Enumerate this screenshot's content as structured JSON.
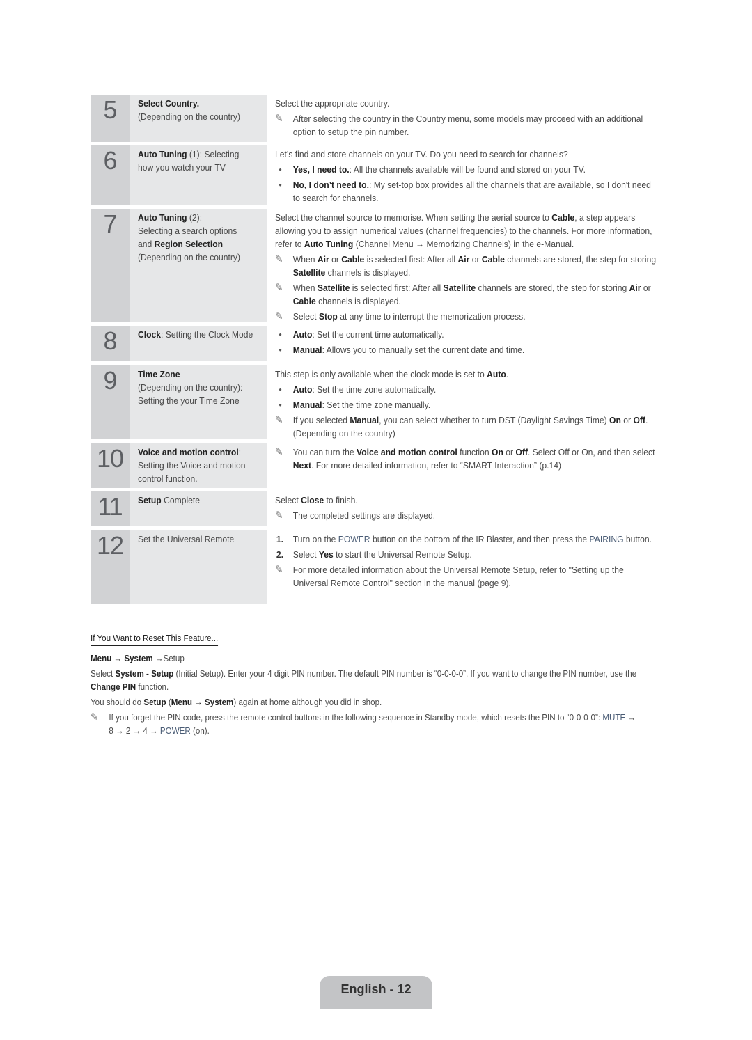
{
  "steps": [
    {
      "number": "5",
      "title_bold": "Select Country.",
      "title_rest": "(Depending on the country)",
      "intro": "Select the appropriate country.",
      "notes": [
        "After selecting the country in the Country menu, some models may proceed with an additional option to setup the pin number."
      ]
    },
    {
      "number": "6",
      "title_bold": "Auto Tuning",
      "title_rest": " (1): Selecting how you watch your TV",
      "intro": "Let’s find and store channels on your TV. Do you need to search for channels?",
      "bullets": [
        {
          "bold": "Yes, I need to.",
          "text": ": All the channels available will be found and stored on your TV."
        },
        {
          "bold": "No, I don’t need to.",
          "text": ": My set-top box provides all the channels that are available, so I don't need to search for channels."
        }
      ]
    },
    {
      "number": "7",
      "title_bold": "Auto Tuning",
      "title_rest": " (2):",
      "title_line2": "Selecting a search options and ",
      "title_bold2": "Region Selection",
      "title_rest2": " (Depending on the country)",
      "intro_a": "Select the channel source to memorise. When setting the aerial source to ",
      "intro_b": "Cable",
      "intro_c": ", a step appears allowing you to assign numerical values (channel frequencies) to the channels. For more information, refer to ",
      "intro_d": "Auto Tuning",
      "intro_e": " (Channel Menu → Memorizing Channels) in the e-Manual.",
      "note1": {
        "a": "When ",
        "b": "Air",
        "c": " or ",
        "d": "Cable",
        "e": " is selected first: After all ",
        "f": "Air",
        "g": " or ",
        "h": "Cable",
        "i": " channels are stored, the step for storing ",
        "j": "Satellite",
        "k": " channels is displayed."
      },
      "note2": {
        "a": "When ",
        "b": "Satellite",
        "c": " is selected first: After all ",
        "d": "Satellite",
        "e": " channels are stored, the step for storing ",
        "f": "Air",
        "g": " or ",
        "h": "Cable",
        "i": " channels is displayed."
      },
      "note3": {
        "a": "Select ",
        "b": "Stop",
        "c": " at any time to interrupt the memorization process."
      }
    },
    {
      "number": "8",
      "title_bold": "Clock",
      "title_rest": ": Setting the Clock Mode",
      "bullets": [
        {
          "bold": "Auto",
          "text": ": Set the current time automatically."
        },
        {
          "bold": "Manual",
          "text": ": Allows you to manually set the current date and time."
        }
      ]
    },
    {
      "number": "9",
      "title_bold": "Time Zone",
      "title_rest": "(Depending on the country): Setting the your Time Zone",
      "intro_a": "This step is only available when the clock mode is set to ",
      "intro_b": "Auto",
      "intro_c": ".",
      "bullets": [
        {
          "bold": "Auto",
          "text": ": Set the time zone automatically."
        },
        {
          "bold": "Manual",
          "text": ": Set the time zone manually."
        }
      ],
      "note": {
        "a": "If you selected ",
        "b": "Manual",
        "c": ", you can select whether to turn DST (Daylight Savings Time) ",
        "d": "On",
        "e": " or ",
        "f": "Off",
        "g": ". (Depending on the country)"
      }
    },
    {
      "number": "10",
      "title_bold": "Voice and motion control",
      "title_rest": ": Setting the Voice and motion control function.",
      "note": {
        "a": "You can turn the ",
        "b": "Voice and motion control",
        "c": " function ",
        "d": "On",
        "e": " or ",
        "f": "Off",
        "g": ". Select Off or On, and then select ",
        "h": "Next",
        "i": ". For more detailed information, refer to “SMART Interaction” (p.14)"
      }
    },
    {
      "number": "11",
      "title_bold": "Setup",
      "title_rest": " Complete",
      "intro_a": "Select ",
      "intro_b": "Close",
      "intro_c": " to finish.",
      "note": "The completed settings are displayed."
    },
    {
      "number": "12",
      "title_rest": "Set the Universal Remote",
      "items": [
        {
          "num": "1.",
          "a": "Turn on the ",
          "b": "POWER",
          "c": " button on the bottom of the IR Blaster, and then press the ",
          "d": "PAIRING",
          "e": " button."
        },
        {
          "num": "2.",
          "a": "Select ",
          "b": "Yes",
          "c": " to start the Universal Remote Setup."
        }
      ],
      "note": "For more detailed information about the Universal Remote Setup, refer to \"Setting up the Universal Remote Control\" section in the manual (page 9)."
    }
  ],
  "reset": {
    "heading": "If You Want to Reset This Feature...",
    "path": {
      "a": "Menu",
      "b": " → ",
      "c": "System",
      "d": " →Setup"
    },
    "p1": {
      "a": "Select ",
      "b": "System - Setup",
      "c": " (Initial Setup). Enter your 4 digit PIN number. The default PIN number is “0-0-0-0”. If you want to change the PIN number, use the ",
      "d": "Change PIN",
      "e": " function."
    },
    "p2": {
      "a": "You should do ",
      "b": "Setup",
      "c": " (",
      "d": "Menu → System",
      "e": ") again at home although you did in shop."
    },
    "note": {
      "a": "If you forget the PIN code, press the remote control buttons in the following sequence in Standby mode, which resets the PIN to “0-0-0-0”: ",
      "b": "MUTE",
      "c": " → 8 → 2 → 4 → ",
      "d": "POWER",
      "e": " (on)."
    }
  },
  "icons": {
    "note": "✎",
    "bullet": "•"
  },
  "footer": "English - 12"
}
